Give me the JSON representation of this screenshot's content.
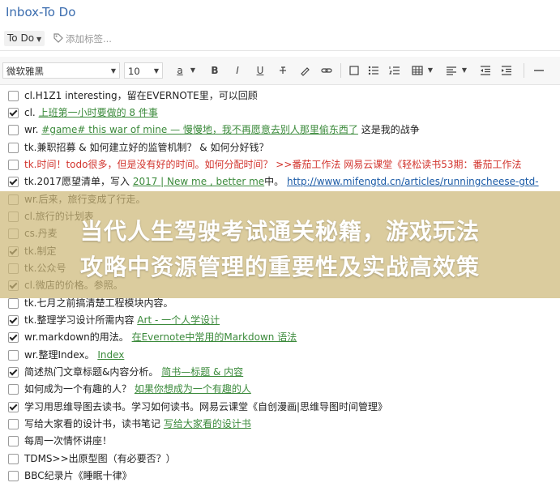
{
  "header": {
    "title": "Inbox-To Do",
    "notebook": "To Do",
    "add_tag_placeholder": "添加标签..."
  },
  "toolbar": {
    "font_family": "微软雅黑",
    "font_size": "10",
    "text_color_label": "a",
    "bold": "B",
    "italic": "I",
    "underline": "U",
    "accent": "#3a6cae"
  },
  "items": [
    {
      "checked": false,
      "parts": [
        {
          "t": "cl.H1Z1 interesting，留在EVERNOTE里，可以回顾",
          "s": ""
        }
      ]
    },
    {
      "checked": true,
      "parts": [
        {
          "t": "cl. ",
          "s": ""
        },
        {
          "t": "上班第一小时要做的 8 件事",
          "s": "link"
        }
      ]
    },
    {
      "checked": false,
      "parts": [
        {
          "t": "wr. ",
          "s": ""
        },
        {
          "t": "#game# this war of mine — 慢慢地，我不再愿意去别人那里偷东西了",
          "s": "link"
        },
        {
          "t": " 这是我的战争",
          "s": ""
        }
      ]
    },
    {
      "checked": false,
      "parts": [
        {
          "t": "tk.兼职招募 & 如何建立好的监管机制？ & 如何分好钱？",
          "s": ""
        }
      ]
    },
    {
      "checked": false,
      "parts": [
        {
          "t": "tk.时间！todo很多，但是没有好的时间。如何分配时间？ >>番茄工作法 网易云课堂《轻松读书53期：番茄工作法",
          "s": "red"
        }
      ]
    },
    {
      "checked": true,
      "parts": [
        {
          "t": "tk.2017愿望清单，写入 ",
          "s": ""
        },
        {
          "t": "2017 | New me , better me",
          "s": "link"
        },
        {
          "t": "中。 ",
          "s": ""
        },
        {
          "t": "http://www.mifengtd.cn/articles/runningcheese-gtd-",
          "s": "link-blue"
        }
      ]
    },
    {
      "checked": false,
      "parts": [
        {
          "t": "wr.后来，旅行变成了行走。",
          "s": ""
        }
      ]
    },
    {
      "checked": false,
      "parts": [
        {
          "t": "cl.旅行的计划表",
          "s": ""
        }
      ]
    },
    {
      "checked": false,
      "parts": [
        {
          "t": "cs.丹麦",
          "s": ""
        }
      ]
    },
    {
      "checked": true,
      "parts": [
        {
          "t": "tk.制定",
          "s": ""
        }
      ]
    },
    {
      "checked": false,
      "parts": [
        {
          "t": "tk.公众号",
          "s": ""
        }
      ]
    },
    {
      "checked": true,
      "parts": [
        {
          "t": "cl.微店的价格。参照。",
          "s": ""
        }
      ]
    },
    {
      "checked": false,
      "parts": [
        {
          "t": "tk.七月之前搞清楚工程模块内容。",
          "s": ""
        }
      ]
    },
    {
      "checked": true,
      "parts": [
        {
          "t": "tk.整理学习设计所需内容 ",
          "s": ""
        },
        {
          "t": "Art - 一个人学设计",
          "s": "link"
        }
      ]
    },
    {
      "checked": true,
      "parts": [
        {
          "t": "wr.markdown的用法。 ",
          "s": ""
        },
        {
          "t": "在Evernote中常用的Markdown 语法",
          "s": "link"
        }
      ]
    },
    {
      "checked": false,
      "parts": [
        {
          "t": "wr.整理Index。 ",
          "s": ""
        },
        {
          "t": "Index",
          "s": "link"
        }
      ]
    },
    {
      "checked": true,
      "parts": [
        {
          "t": "简述热门文章标题&内容分析。 ",
          "s": ""
        },
        {
          "t": "简书—标题 & 内容",
          "s": "link"
        }
      ]
    },
    {
      "checked": false,
      "parts": [
        {
          "t": "如何成为一个有趣的人？ ",
          "s": ""
        },
        {
          "t": "如果你想成为一个有趣的人",
          "s": "link"
        }
      ]
    },
    {
      "checked": true,
      "parts": [
        {
          "t": "学习用思维导图去读书。学习如何读书。网易云课堂《自创漫画|思维导图时间管理》",
          "s": ""
        }
      ]
    },
    {
      "checked": false,
      "parts": [
        {
          "t": "写给大家看的设计书，读书笔记 ",
          "s": ""
        },
        {
          "t": "写给大家看的设计书",
          "s": "link"
        }
      ]
    },
    {
      "checked": false,
      "parts": [
        {
          "t": "每周一次情怀讲座！",
          "s": ""
        }
      ]
    },
    {
      "checked": false,
      "parts": [
        {
          "t": "TDMS>>出原型图（有必要否？）",
          "s": ""
        }
      ]
    },
    {
      "checked": false,
      "parts": [
        {
          "t": " BBC纪录片《睡眠十律》",
          "s": ""
        }
      ]
    }
  ],
  "banner": {
    "line1": "当代人生驾驶考试通关秘籍，游戏玩法",
    "line2": "攻略中资源管理的重要性及实战高效策"
  }
}
